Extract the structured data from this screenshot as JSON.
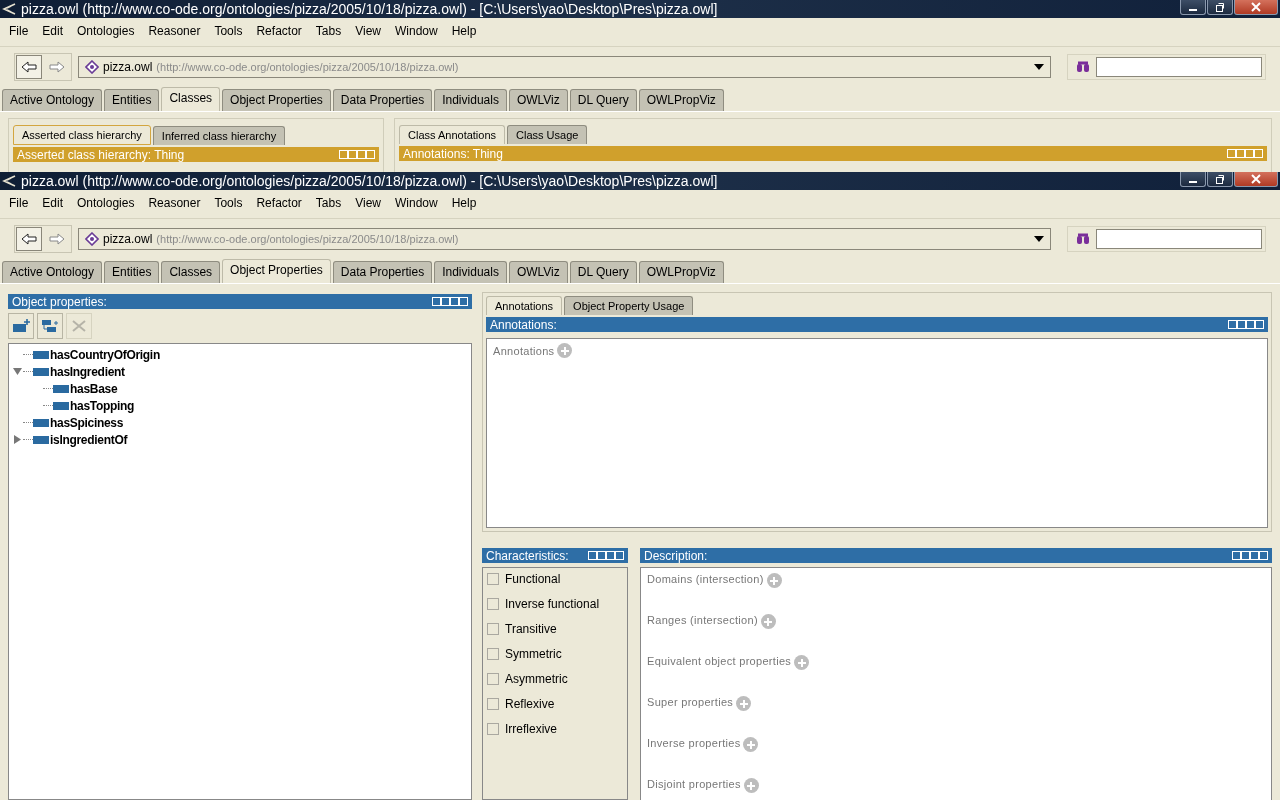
{
  "windows": [
    {
      "title": "pizza.owl (http://www.co-ode.org/ontologies/pizza/2005/10/18/pizza.owl) - [C:\\Users\\yao\\Desktop\\Pres\\pizza.owl]",
      "menu": [
        "File",
        "Edit",
        "Ontologies",
        "Reasoner",
        "Tools",
        "Refactor",
        "Tabs",
        "View",
        "Window",
        "Help"
      ],
      "ontology": {
        "name": "pizza.owl",
        "iri": "(http://www.co-ode.org/ontologies/pizza/2005/10/18/pizza.owl)"
      },
      "tabs": [
        {
          "label": "Active Ontology",
          "selected": false
        },
        {
          "label": "Entities",
          "selected": false
        },
        {
          "label": "Classes",
          "selected": true
        },
        {
          "label": "Object Properties",
          "selected": false
        },
        {
          "label": "Data Properties",
          "selected": false
        },
        {
          "label": "Individuals",
          "selected": false
        },
        {
          "label": "OWLViz",
          "selected": false
        },
        {
          "label": "DL Query",
          "selected": false
        },
        {
          "label": "OWLPropViz",
          "selected": false
        }
      ],
      "body": {
        "kind": "classes",
        "left": {
          "subtabs": [
            {
              "label": "Asserted class hierarchy",
              "selected": true
            },
            {
              "label": "Inferred class hierarchy",
              "selected": false
            }
          ],
          "header": "Asserted class hierarchy: Thing"
        },
        "right": {
          "subtabs": [
            {
              "label": "Class Annotations",
              "selected": true
            },
            {
              "label": "Class Usage",
              "selected": false
            }
          ],
          "header": "Annotations: Thing"
        }
      }
    },
    {
      "title": "pizza.owl (http://www.co-ode.org/ontologies/pizza/2005/10/18/pizza.owl) - [C:\\Users\\yao\\Desktop\\Pres\\pizza.owl]",
      "menu": [
        "File",
        "Edit",
        "Ontologies",
        "Reasoner",
        "Tools",
        "Refactor",
        "Tabs",
        "View",
        "Window",
        "Help"
      ],
      "ontology": {
        "name": "pizza.owl",
        "iri": "(http://www.co-ode.org/ontologies/pizza/2005/10/18/pizza.owl)"
      },
      "tabs": [
        {
          "label": "Active Ontology",
          "selected": false
        },
        {
          "label": "Entities",
          "selected": false
        },
        {
          "label": "Classes",
          "selected": false
        },
        {
          "label": "Object Properties",
          "selected": true
        },
        {
          "label": "Data Properties",
          "selected": false
        },
        {
          "label": "Individuals",
          "selected": false
        },
        {
          "label": "OWLViz",
          "selected": false
        },
        {
          "label": "DL Query",
          "selected": false
        },
        {
          "label": "OWLPropViz",
          "selected": false
        }
      ],
      "body": {
        "kind": "object_properties",
        "hierarchy": {
          "header": "Object properties:",
          "tree": [
            {
              "name": "hasCountryOfOrigin"
            },
            {
              "name": "hasIngredient",
              "expanded": true,
              "children": [
                {
                  "name": "hasBase"
                },
                {
                  "name": "hasTopping"
                }
              ]
            },
            {
              "name": "hasSpiciness"
            },
            {
              "name": "isIngredientOf",
              "expanded": false
            }
          ]
        },
        "annotations": {
          "subtabs": [
            {
              "label": "Annotations",
              "selected": true
            },
            {
              "label": "Object Property Usage",
              "selected": false
            }
          ],
          "header": "Annotations:",
          "label": "Annotations"
        },
        "characteristics": {
          "header": "Characteristics:",
          "items": [
            {
              "label": "Functional",
              "checked": false
            },
            {
              "label": "Inverse functional",
              "checked": false
            },
            {
              "label": "Transitive",
              "checked": false
            },
            {
              "label": "Symmetric",
              "checked": false
            },
            {
              "label": "Asymmetric",
              "checked": false
            },
            {
              "label": "Reflexive",
              "checked": false
            },
            {
              "label": "Irreflexive",
              "checked": false
            }
          ]
        },
        "description": {
          "header": "Description:",
          "sections": [
            "Domains (intersection)",
            "Ranges (intersection)",
            "Equivalent object properties",
            "Super properties",
            "Inverse properties",
            "Disjoint properties"
          ]
        }
      }
    }
  ]
}
